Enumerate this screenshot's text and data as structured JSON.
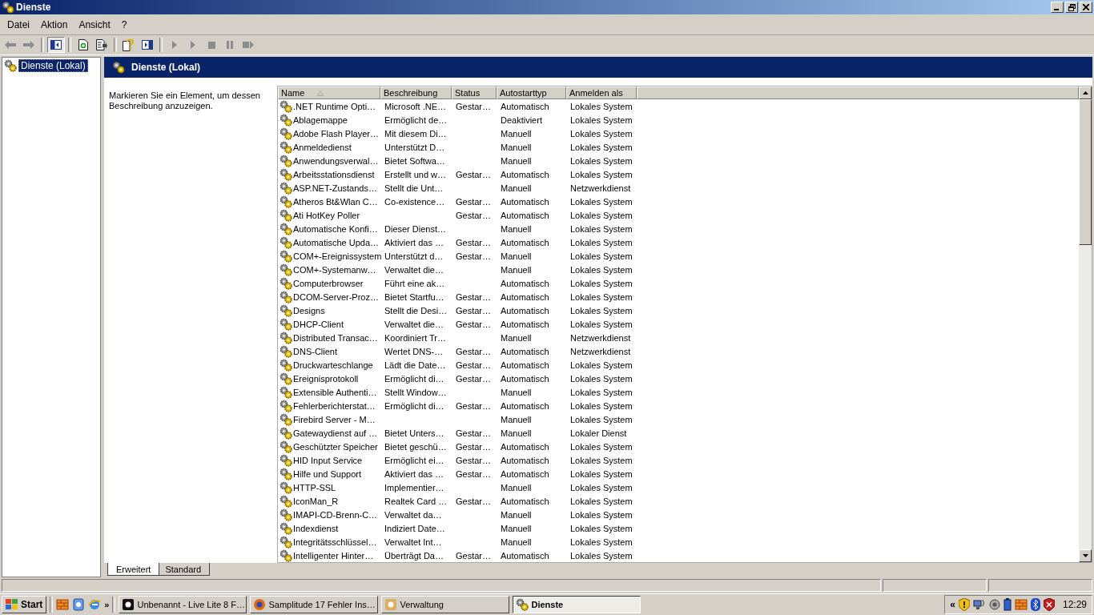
{
  "window": {
    "title": "Dienste"
  },
  "menu": [
    "Datei",
    "Aktion",
    "Ansicht",
    "?"
  ],
  "tree": [
    {
      "label": "Dienste (Lokal)",
      "selected": true
    }
  ],
  "panel": {
    "title": "Dienste (Lokal)",
    "hint": "Markieren Sie ein Element, um dessen Beschreibung anzuzeigen."
  },
  "table": {
    "columns": [
      "Name",
      "Beschreibung",
      "Status",
      "Autostarttyp",
      "Anmelden als"
    ],
    "rows": [
      [
        ".NET Runtime Opti…",
        "Microsoft .NE…",
        "Gestar…",
        "Automatisch",
        "Lokales System"
      ],
      [
        "Ablagemappe",
        "Ermöglicht de…",
        "",
        "Deaktiviert",
        "Lokales System"
      ],
      [
        "Adobe Flash Player…",
        "Mit diesem Di…",
        "",
        "Manuell",
        "Lokales System"
      ],
      [
        "Anmeldedienst",
        "Unterstützt D…",
        "",
        "Manuell",
        "Lokales System"
      ],
      [
        "Anwendungsverwal…",
        "Bietet Softwa…",
        "",
        "Manuell",
        "Lokales System"
      ],
      [
        "Arbeitsstationsdienst",
        "Erstellt und w…",
        "Gestar…",
        "Automatisch",
        "Lokales System"
      ],
      [
        "ASP.NET-Zustands…",
        "Stellt die Unt…",
        "",
        "Manuell",
        "Netzwerkdienst"
      ],
      [
        "Atheros Bt&Wlan C…",
        "Co-existence…",
        "Gestar…",
        "Automatisch",
        "Lokales System"
      ],
      [
        "Ati HotKey Poller",
        "",
        "Gestar…",
        "Automatisch",
        "Lokales System"
      ],
      [
        "Automatische Konfi…",
        "Dieser Dienst…",
        "",
        "Manuell",
        "Lokales System"
      ],
      [
        "Automatische Upda…",
        "Aktiviert das …",
        "Gestar…",
        "Automatisch",
        "Lokales System"
      ],
      [
        "COM+-Ereignissystem",
        "Unterstützt d…",
        "Gestar…",
        "Manuell",
        "Lokales System"
      ],
      [
        "COM+-Systemanw…",
        "Verwaltet die…",
        "",
        "Manuell",
        "Lokales System"
      ],
      [
        "Computerbrowser",
        "Führt eine ak…",
        "",
        "Automatisch",
        "Lokales System"
      ],
      [
        "DCOM-Server-Proz…",
        "Bietet Startfu…",
        "Gestar…",
        "Automatisch",
        "Lokales System"
      ],
      [
        "Designs",
        "Stellt die Desi…",
        "Gestar…",
        "Automatisch",
        "Lokales System"
      ],
      [
        "DHCP-Client",
        "Verwaltet die…",
        "Gestar…",
        "Automatisch",
        "Lokales System"
      ],
      [
        "Distributed Transac…",
        "Koordiniert Tr…",
        "",
        "Manuell",
        "Netzwerkdienst"
      ],
      [
        "DNS-Client",
        "Wertet DNS-…",
        "Gestar…",
        "Automatisch",
        "Netzwerkdienst"
      ],
      [
        "Druckwarteschlange",
        "Lädt die Date…",
        "Gestar…",
        "Automatisch",
        "Lokales System"
      ],
      [
        "Ereignisprotokoll",
        "Ermöglicht di…",
        "Gestar…",
        "Automatisch",
        "Lokales System"
      ],
      [
        "Extensible Authenti…",
        "Stellt Window…",
        "",
        "Manuell",
        "Lokales System"
      ],
      [
        "Fehlerberichterstat…",
        "Ermöglicht di…",
        "Gestar…",
        "Automatisch",
        "Lokales System"
      ],
      [
        "Firebird Server - M…",
        "",
        "",
        "Manuell",
        "Lokales System"
      ],
      [
        "Gatewaydienst auf …",
        "Bietet Unters…",
        "Gestar…",
        "Manuell",
        "Lokaler Dienst"
      ],
      [
        "Geschützter Speicher",
        "Bietet geschü…",
        "Gestar…",
        "Automatisch",
        "Lokales System"
      ],
      [
        "HID Input Service",
        "Ermöglicht ei…",
        "Gestar…",
        "Automatisch",
        "Lokales System"
      ],
      [
        "Hilfe und Support",
        "Aktiviert das …",
        "Gestar…",
        "Automatisch",
        "Lokales System"
      ],
      [
        "HTTP-SSL",
        "Implementier…",
        "",
        "Manuell",
        "Lokales System"
      ],
      [
        "IconMan_R",
        "Realtek Card …",
        "Gestar…",
        "Automatisch",
        "Lokales System"
      ],
      [
        "IMAPI-CD-Brenn-C…",
        "Verwaltet da…",
        "",
        "Manuell",
        "Lokales System"
      ],
      [
        "Indexdienst",
        "Indiziert Date…",
        "",
        "Manuell",
        "Lokales System"
      ],
      [
        "Integritätsschlüssel…",
        "Verwaltet Int…",
        "",
        "Manuell",
        "Lokales System"
      ],
      [
        "Intelligenter Hinter…",
        "Überträgt Da…",
        "Gestar…",
        "Automatisch",
        "Lokales System"
      ]
    ]
  },
  "tabs": [
    {
      "label": "Erweitert",
      "selected": true
    },
    {
      "label": "Standard",
      "selected": false
    }
  ],
  "taskbar": {
    "start": "Start",
    "more": "»",
    "tasks": [
      {
        "label": "Unbenannt - Live Lite 8 F…",
        "selected": false
      },
      {
        "label": "Samplitude 17 Fehler Ins…",
        "selected": false
      },
      {
        "label": "Verwaltung",
        "selected": false
      },
      {
        "label": "Dienste",
        "selected": true
      }
    ],
    "tray_toggle": "«",
    "clock": "12:29"
  }
}
